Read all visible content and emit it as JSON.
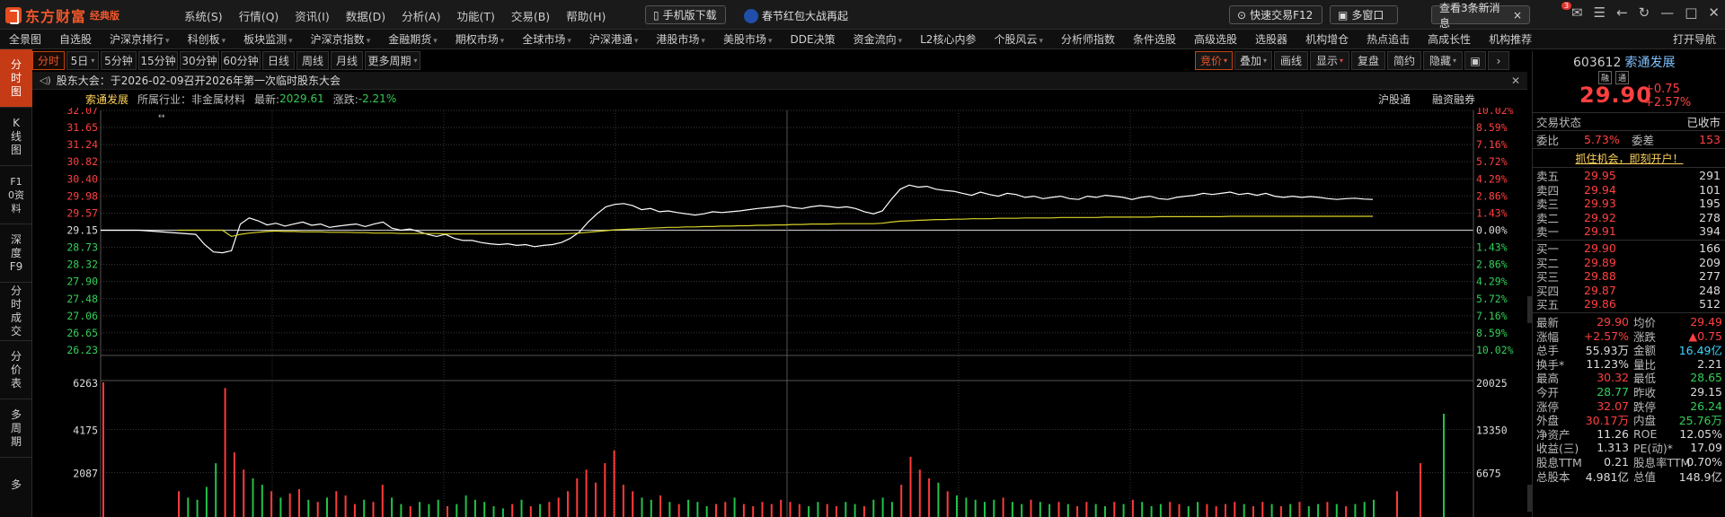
{
  "app": {
    "name": "东方财富",
    "edition": "经典版"
  },
  "menu": [
    "系统(S)",
    "行情(Q)",
    "资讯(I)",
    "数据(D)",
    "分析(A)",
    "功能(T)",
    "交易(B)",
    "帮助(H)"
  ],
  "titlebar": {
    "mobile_download": "手机版下载",
    "redpack": "春节红包大战再起",
    "quick_trade": "快速交易F12",
    "multi_window": "多窗口",
    "news": "查看3条新消息",
    "news_badge": "3"
  },
  "nav": [
    "全景图",
    "自选股",
    "沪深京排行",
    "科创板",
    "板块监测",
    "沪深京指数",
    "金融期货",
    "期权市场",
    "全球市场",
    "沪深港通",
    "港股市场",
    "美股市场",
    "DDE决策",
    "资金流向",
    "L2核心内参",
    "个股风云",
    "分析师指数",
    "条件选股",
    "高级选股",
    "选股器",
    "机构增仓",
    "热点追击",
    "高成长性",
    "机构推荐",
    "打开导航"
  ],
  "nav_dropdown": [
    false,
    false,
    true,
    true,
    true,
    true,
    true,
    true,
    true,
    true,
    true,
    true,
    false,
    true,
    false,
    true,
    false,
    false,
    false,
    false,
    false,
    false,
    false,
    false,
    false
  ],
  "vtabs": [
    "分时图",
    "K线图",
    "F10资料",
    "深度F9",
    "分时成交",
    "分价表",
    "多周期",
    "多"
  ],
  "periods": [
    "分时",
    "5日",
    "5分钟",
    "15分钟",
    "30分钟",
    "60分钟",
    "日线",
    "周线",
    "月线",
    "更多周期"
  ],
  "tools": [
    "竞价",
    "叠加",
    "画线",
    "显示",
    "复盘",
    "简约",
    "隐藏"
  ],
  "notice": "股东大会：于2026-02-09召开2026年第一次临时股东大会",
  "info": {
    "name": "索通发展",
    "industry_label": "所属行业：",
    "industry": "非金属材料",
    "latest_label": "最新:",
    "latest": "2029.61",
    "change_label": "涨跌:",
    "change": "-2.21%",
    "right1": "沪股通",
    "right2": "融资融券"
  },
  "chart_data": {
    "type": "line",
    "title": "",
    "y_left": [
      "32.07",
      "31.65",
      "31.24",
      "30.82",
      "30.40",
      "29.98",
      "29.57",
      "29.15",
      "28.73",
      "28.32",
      "27.90",
      "27.48",
      "27.06",
      "26.65",
      "26.23"
    ],
    "y_right": [
      "10.02%",
      "8.59%",
      "7.16%",
      "5.72%",
      "4.29%",
      "2.86%",
      "1.43%",
      "0.00%",
      "1.43%",
      "2.86%",
      "4.29%",
      "5.72%",
      "7.16%",
      "8.59%",
      "10.02%"
    ],
    "ylim": [
      26.23,
      32.07
    ],
    "prev_close": 29.15,
    "vol_left": [
      "6263",
      "4175",
      "2087"
    ],
    "vol_right": [
      "20025",
      "13350",
      "6675"
    ],
    "series": [
      {
        "color": "#ffffff",
        "values": [
          29.15,
          29.15,
          29.05,
          28.8,
          28.62,
          28.6,
          28.65,
          29.3,
          29.45,
          29.38,
          29.28,
          29.32,
          29.25,
          29.3,
          29.35,
          29.27,
          29.3,
          29.22,
          29.25,
          29.28,
          29.3,
          29.24,
          29.3,
          29.35,
          29.2,
          29.15,
          29.18,
          29.12,
          29.05,
          29.0,
          29.05,
          28.95,
          28.9,
          28.9,
          28.85,
          28.82,
          28.8,
          28.82,
          28.78,
          28.8,
          28.75,
          28.78,
          28.8,
          28.85,
          28.95,
          29.1,
          29.35,
          29.55,
          29.72,
          29.78,
          29.8,
          29.75,
          29.65,
          29.68,
          29.6,
          29.62,
          29.58,
          29.55,
          29.52,
          29.55,
          29.6,
          29.58,
          29.6,
          29.62,
          29.65,
          29.68,
          29.7,
          29.72,
          29.75,
          29.7,
          29.68,
          29.72,
          29.75,
          29.73,
          29.7,
          29.72,
          29.68,
          29.6,
          29.55,
          29.62,
          29.9,
          30.15,
          30.25,
          30.2,
          30.22,
          30.15,
          30.12,
          30.1,
          30.05,
          30.0,
          30.08,
          30.02,
          29.98,
          30.05,
          30.02,
          29.95,
          29.98,
          29.92,
          29.95,
          29.98,
          29.92,
          29.9,
          29.98,
          29.95,
          30.0,
          29.98,
          29.95,
          29.9,
          29.95,
          29.98,
          29.92,
          29.9,
          29.95,
          29.98,
          30.0,
          30.05,
          30.02,
          30.05,
          30.08,
          30.02,
          30.05,
          30.0,
          30.05,
          29.98,
          29.95,
          29.98,
          29.95,
          29.97,
          29.95,
          29.92,
          29.9,
          29.92,
          29.93,
          29.91,
          29.9
        ]
      },
      {
        "color": "#d9d22a",
        "values": [
          29.15,
          29.15,
          29.15,
          29.15,
          29.15,
          29.15,
          29.0,
          29.05,
          29.08,
          29.1,
          29.12,
          29.13,
          29.12,
          29.12,
          29.11,
          29.11,
          29.11,
          29.1,
          29.1,
          29.1,
          29.09,
          29.09,
          29.08,
          29.08,
          29.08,
          29.07,
          29.07,
          29.07,
          29.07,
          29.07,
          29.06,
          29.06,
          29.06,
          29.06,
          29.06,
          29.06,
          29.06,
          29.06,
          29.06,
          29.06,
          29.06,
          29.06,
          29.06,
          29.06,
          29.07,
          29.08,
          29.1,
          29.12,
          29.14,
          29.16,
          29.17,
          29.18,
          29.19,
          29.2,
          29.21,
          29.22,
          29.22,
          29.23,
          29.23,
          29.24,
          29.24,
          29.25,
          29.25,
          29.26,
          29.26,
          29.27,
          29.27,
          29.28,
          29.28,
          29.29,
          29.29,
          29.3,
          29.3,
          29.3,
          29.31,
          29.31,
          29.31,
          29.31,
          29.31,
          29.32,
          29.35,
          29.37,
          29.38,
          29.39,
          29.4,
          29.41,
          29.41,
          29.42,
          29.42,
          29.43,
          29.43,
          29.43,
          29.44,
          29.44,
          29.44,
          29.45,
          29.45,
          29.45,
          29.45,
          29.46,
          29.46,
          29.46,
          29.46,
          29.46,
          29.47,
          29.47,
          29.47,
          29.47,
          29.47,
          29.47,
          29.48,
          29.48,
          29.48,
          29.48,
          29.48,
          29.48,
          29.48,
          29.48,
          29.49,
          29.49,
          29.49,
          29.49,
          29.49,
          29.49,
          29.49,
          29.49,
          29.49,
          29.49,
          29.49,
          29.49,
          29.49,
          29.49,
          29.49,
          29.49,
          29.49
        ]
      }
    ],
    "volume_max": 6263,
    "volumes": [
      6263,
      1200,
      900,
      800,
      1400,
      2500,
      6000,
      3000,
      2200,
      1800,
      1500,
      1200,
      900,
      1100,
      1300,
      800,
      700,
      900,
      1200,
      1000,
      600,
      800,
      700,
      1500,
      900,
      600,
      500,
      700,
      600,
      800,
      500,
      600,
      1000,
      800,
      700,
      500,
      400,
      600,
      800,
      500,
      600,
      700,
      900,
      1200,
      1800,
      2200,
      1600,
      2500,
      3100,
      1500,
      1200,
      900,
      800,
      1000,
      700,
      600,
      800,
      700,
      500,
      600,
      700,
      900,
      600,
      500,
      700,
      600,
      800,
      700,
      600,
      500,
      700,
      600,
      500,
      700,
      600,
      500,
      800,
      900,
      700,
      1500,
      2800,
      2200,
      1800,
      1600,
      1200,
      1000,
      900,
      800,
      700,
      800,
      900,
      700,
      600,
      800,
      700,
      600,
      700,
      600,
      500,
      700,
      600,
      500,
      700,
      600,
      800,
      700,
      500,
      600,
      700,
      600,
      500,
      700,
      600,
      500,
      600,
      700,
      600,
      500,
      700,
      600,
      500,
      600,
      700,
      500,
      600,
      700,
      600,
      500,
      600,
      700,
      800,
      1200,
      2500,
      4800
    ],
    "volume_up": [
      true,
      true,
      false,
      false,
      false,
      false,
      true,
      true,
      true,
      false,
      false,
      true,
      false,
      true,
      true,
      false,
      true,
      false,
      true,
      true,
      true,
      false,
      true,
      true,
      false,
      false,
      true,
      false,
      false,
      false,
      true,
      false,
      false,
      false,
      false,
      false,
      false,
      true,
      false,
      true,
      false,
      true,
      true,
      true,
      true,
      true,
      true,
      true,
      true,
      true,
      true,
      false,
      false,
      true,
      false,
      true,
      false,
      false,
      false,
      true,
      true,
      false,
      true,
      true,
      true,
      true,
      true,
      true,
      true,
      false,
      false,
      true,
      true,
      false,
      false,
      true,
      false,
      false,
      false,
      true,
      true,
      true,
      true,
      false,
      true,
      false,
      false,
      false,
      false,
      false,
      true,
      false,
      false,
      true,
      false,
      false,
      true,
      false,
      true,
      true,
      false,
      false,
      true,
      false,
      true,
      false,
      false,
      false,
      true,
      true,
      false,
      false,
      true,
      true,
      true,
      true,
      false,
      true,
      true,
      false,
      true,
      false,
      true,
      false,
      false,
      true,
      false,
      true,
      false,
      false,
      false,
      true,
      true,
      false,
      true
    ]
  },
  "panel": {
    "code": "603612",
    "name": "索通发展",
    "tag1": "融",
    "tag2": "通",
    "price": "29.90",
    "change": "+0.75",
    "change_pct": "+2.57%",
    "trade_status_label": "交易状态",
    "trade_status": "已收市",
    "weibi_label": "委比",
    "weibi": "5.73%",
    "weicha_label": "委差",
    "weicha": "153",
    "ad": "抓住机会，即刻开户！",
    "asks": [
      {
        "label": "卖五",
        "price": "29.95",
        "vol": "291"
      },
      {
        "label": "卖四",
        "price": "29.94",
        "vol": "101"
      },
      {
        "label": "卖三",
        "price": "29.93",
        "vol": "195"
      },
      {
        "label": "卖二",
        "price": "29.92",
        "vol": "278"
      },
      {
        "label": "卖一",
        "price": "29.91",
        "vol": "394"
      }
    ],
    "bids": [
      {
        "label": "买一",
        "price": "29.90",
        "vol": "166"
      },
      {
        "label": "买二",
        "price": "29.89",
        "vol": "209"
      },
      {
        "label": "买三",
        "price": "29.88",
        "vol": "277"
      },
      {
        "label": "买四",
        "price": "29.87",
        "vol": "248"
      },
      {
        "label": "买五",
        "price": "29.86",
        "vol": "512"
      }
    ],
    "stats": [
      [
        {
          "l": "最新",
          "v": "29.90",
          "c": "red"
        },
        {
          "l": "均价",
          "v": "29.49",
          "c": "red"
        }
      ],
      [
        {
          "l": "涨幅",
          "v": "+2.57%",
          "c": "red"
        },
        {
          "l": "涨跌",
          "v": "▲0.75",
          "c": "red"
        }
      ],
      [
        {
          "l": "总手",
          "v": "55.93万",
          "c": "white"
        },
        {
          "l": "金额",
          "v": "16.49亿",
          "c": "cyan"
        }
      ],
      [
        {
          "l": "换手*",
          "v": "11.23%",
          "c": "white"
        },
        {
          "l": "量比",
          "v": "2.21",
          "c": "white"
        }
      ],
      [
        {
          "l": "最高",
          "v": "30.32",
          "c": "red"
        },
        {
          "l": "最低",
          "v": "28.65",
          "c": "green"
        }
      ],
      [
        {
          "l": "今开",
          "v": "28.77",
          "c": "green"
        },
        {
          "l": "昨收",
          "v": "29.15",
          "c": "white"
        }
      ],
      [
        {
          "l": "涨停",
          "v": "32.07",
          "c": "red"
        },
        {
          "l": "跌停",
          "v": "26.24",
          "c": "green"
        }
      ],
      [
        {
          "l": "外盘",
          "v": "30.17万",
          "c": "red"
        },
        {
          "l": "内盘",
          "v": "25.76万",
          "c": "green"
        }
      ],
      [
        {
          "l": "净资产",
          "v": "11.26",
          "c": "white"
        },
        {
          "l": "ROE",
          "v": "12.05%",
          "c": "white"
        }
      ],
      [
        {
          "l": "收益(三)",
          "v": "1.313",
          "c": "white"
        },
        {
          "l": "PE(动)*",
          "v": "17.09",
          "c": "white"
        }
      ],
      [
        {
          "l": "股息TTM",
          "v": "0.21",
          "c": "white"
        },
        {
          "l": "股息率TTM",
          "v": "0.70%",
          "c": "white"
        }
      ],
      [
        {
          "l": "总股本",
          "v": "4.981亿",
          "c": "white"
        },
        {
          "l": "总值",
          "v": "148.9亿",
          "c": "white"
        }
      ]
    ]
  }
}
